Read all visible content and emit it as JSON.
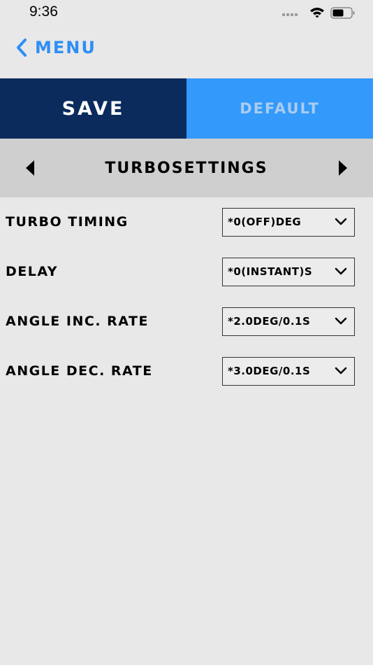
{
  "status_bar": {
    "time": "9:36",
    "icons": [
      "signal-icon",
      "wifi-icon",
      "battery-icon"
    ]
  },
  "nav": {
    "back_label": "MENU",
    "back_icon": "chevron-left-icon"
  },
  "actions": {
    "save_label": "SAVE",
    "default_label": "DEFAULT"
  },
  "section": {
    "title": "TURBOSETTINGS",
    "prev_icon": "triangle-left-icon",
    "next_icon": "triangle-right-icon"
  },
  "settings": [
    {
      "label": "TURBO TIMING",
      "value": "*0(OFF)DEG"
    },
    {
      "label": "DELAY",
      "value": "*0(INSTANT)S"
    },
    {
      "label": "ANGLE INC. RATE",
      "value": "*2.0DEG/0.1S"
    },
    {
      "label": "ANGLE DEC. RATE",
      "value": "*3.0DEG/0.1S"
    }
  ],
  "colors": {
    "accent": "#2e8ff5",
    "save_bg": "#0a2b5c",
    "default_bg": "#3399fb",
    "background": "#e8e8e8",
    "header_bg": "#cfcfcf"
  }
}
